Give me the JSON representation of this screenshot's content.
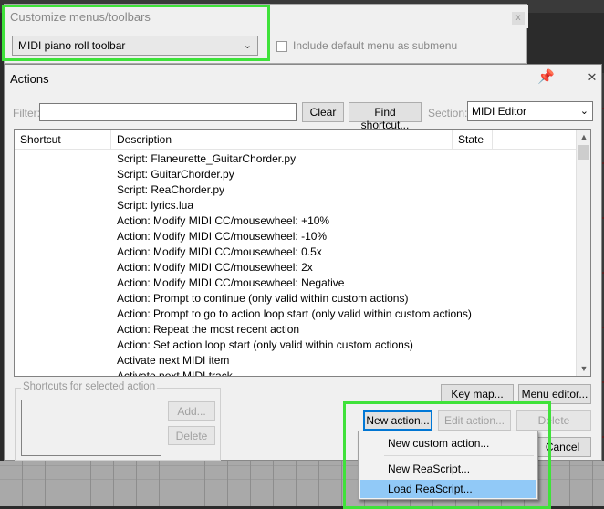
{
  "customize": {
    "title": "Customize menus/toolbars",
    "close_label": "x",
    "toolbar_selected": "MIDI piano roll toolbar",
    "include_default_label": "Include default menu as submenu"
  },
  "actions": {
    "title": "Actions",
    "close_label": "✕",
    "filter_label": "Filter:",
    "filter_value": "",
    "clear_label": "Clear",
    "find_shortcut_label": "Find shortcut...",
    "section_label": "Section:",
    "section_value": "MIDI Editor",
    "columns": [
      "Shortcut",
      "Description",
      "State"
    ],
    "rows": [
      "Script: Flaneurette_GuitarChorder.py",
      "Script: GuitarChorder.py",
      "Script: ReaChorder.py",
      "Script: lyrics.lua",
      "Action: Modify MIDI CC/mousewheel: +10%",
      "Action: Modify MIDI CC/mousewheel: -10%",
      "Action: Modify MIDI CC/mousewheel: 0.5x",
      "Action: Modify MIDI CC/mousewheel: 2x",
      "Action: Modify MIDI CC/mousewheel: Negative",
      "Action: Prompt to continue (only valid within custom actions)",
      "Action: Prompt to go to action loop start (only valid within custom actions)",
      "Action: Repeat the most recent action",
      "Action: Set action loop start (only valid within custom actions)",
      "Activate next MIDI item",
      "Activate next MIDI track"
    ],
    "shortcuts_group_label": "Shortcuts for selected action",
    "add_label": "Add...",
    "delete_shortcut_label": "Delete",
    "key_map_label": "Key map...",
    "menu_editor_label": "Menu editor...",
    "new_action_label": "New action...",
    "edit_action_label": "Edit action...",
    "delete_label": "Delete",
    "cancel_label": "Cancel"
  },
  "popup_menu": {
    "items": [
      "New custom action...",
      "New ReaScript...",
      "Load ReaScript..."
    ],
    "highlighted": "Load ReaScript..."
  },
  "colors": {
    "highlight_box": "#3fe23a",
    "menu_selection": "#91c9f7"
  }
}
